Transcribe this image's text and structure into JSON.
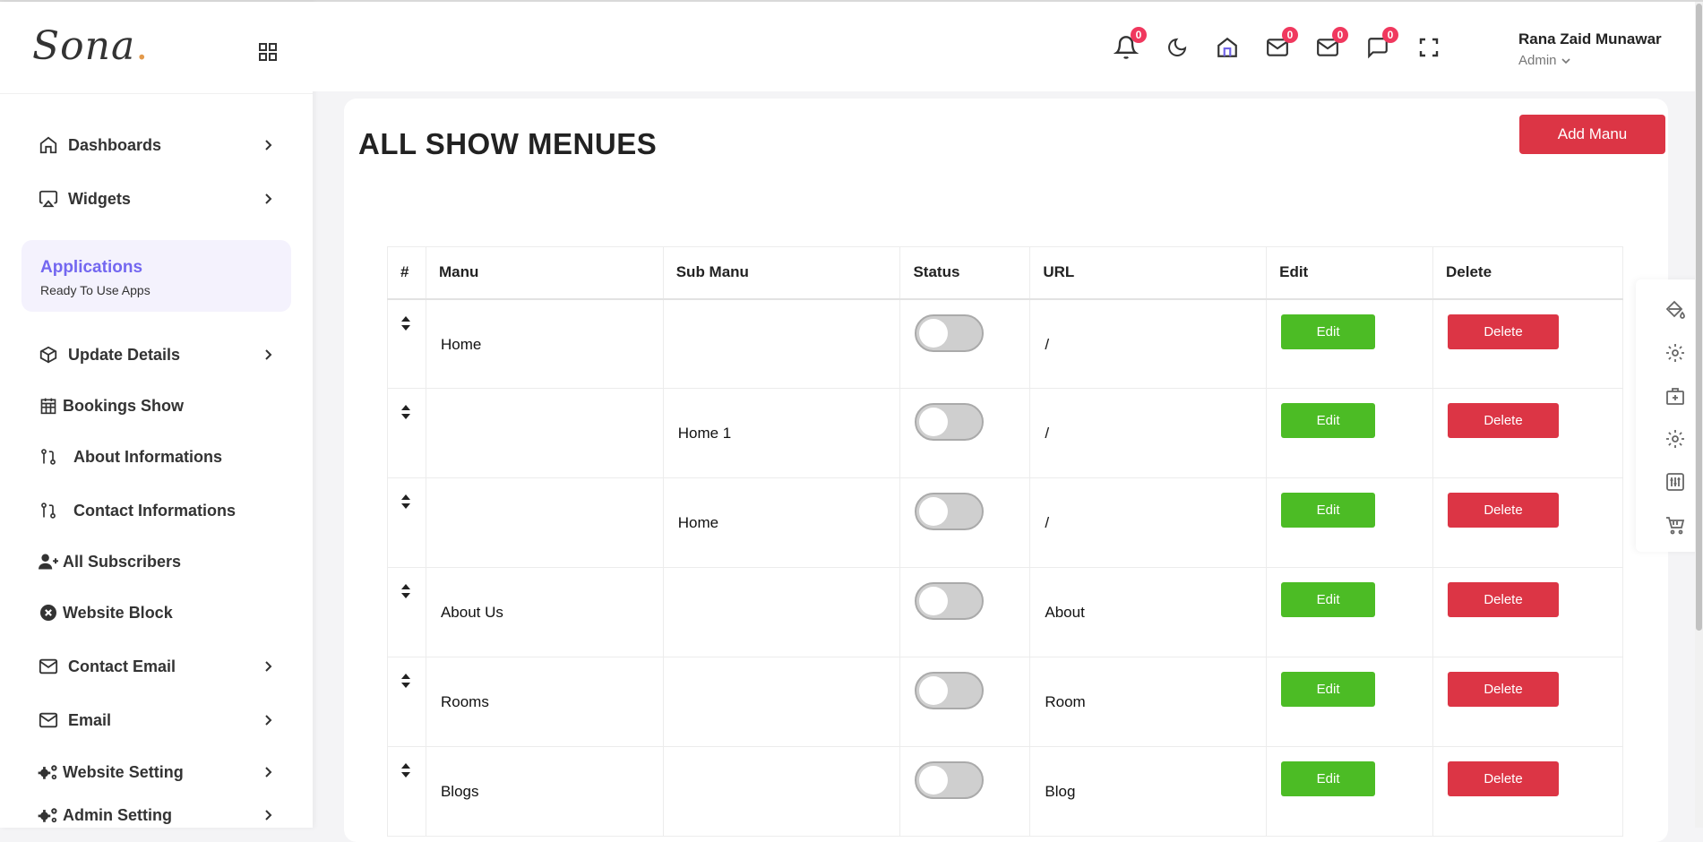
{
  "app": {
    "logo_text": "Sona",
    "logo_dot": "."
  },
  "sidebar": {
    "items_top": [
      {
        "label": "Dashboards",
        "icon": "home-icon",
        "chevron": true
      },
      {
        "label": "Widgets",
        "icon": "airplay-icon",
        "chevron": true
      }
    ],
    "apps_box": {
      "title": "Applications",
      "subtitle": "Ready To Use Apps"
    },
    "items": [
      {
        "label": "Update Details",
        "icon": "box-icon",
        "chevron": true
      },
      {
        "label": "Bookings Show",
        "icon": "calendar-icon",
        "chevron": false
      },
      {
        "label": "About Informations",
        "icon": "git-pull-request-icon",
        "chevron": false
      },
      {
        "label": "Contact Informations",
        "icon": "git-pull-request-icon",
        "chevron": false
      },
      {
        "label": "All Subscribers",
        "icon": "user-plus-icon",
        "chevron": false
      },
      {
        "label": "Website Block",
        "icon": "times-circle-icon",
        "chevron": false
      },
      {
        "label": "Contact Email",
        "icon": "mail-icon",
        "chevron": true
      },
      {
        "label": "Email",
        "icon": "mail-icon",
        "chevron": true
      },
      {
        "label": "Website Setting",
        "icon": "cogs-icon",
        "chevron": true
      },
      {
        "label": "Admin Setting",
        "icon": "cogs-icon",
        "chevron": true
      }
    ]
  },
  "header": {
    "badges": {
      "notifications": "0",
      "mail1": "0",
      "mail2": "0",
      "chat": "0"
    },
    "user": {
      "name": "Rana Zaid Munawar",
      "role": "Admin"
    }
  },
  "main": {
    "title": "ALL SHOW MENUES",
    "add_button": "Add Manu",
    "columns": [
      "#",
      "Manu",
      "Sub Manu",
      "Status",
      "URL",
      "Edit",
      "Delete"
    ],
    "edit_label": "Edit",
    "delete_label": "Delete",
    "rows": [
      {
        "manu": "Home",
        "sub": "",
        "status": false,
        "url": "/"
      },
      {
        "manu": "",
        "sub": "Home 1",
        "status": false,
        "url": "/"
      },
      {
        "manu": "",
        "sub": "Home",
        "status": false,
        "url": "/"
      },
      {
        "manu": "About Us",
        "sub": "",
        "status": false,
        "url": "About"
      },
      {
        "manu": "Rooms",
        "sub": "",
        "status": false,
        "url": "Room"
      },
      {
        "manu": "Blogs",
        "sub": "",
        "status": false,
        "url": "Blog"
      }
    ]
  },
  "right_toolbar": [
    "paint-bucket-icon",
    "settings-icon",
    "medical-bag-icon",
    "settings-icon",
    "sliders-icon",
    "cart-icon"
  ]
}
